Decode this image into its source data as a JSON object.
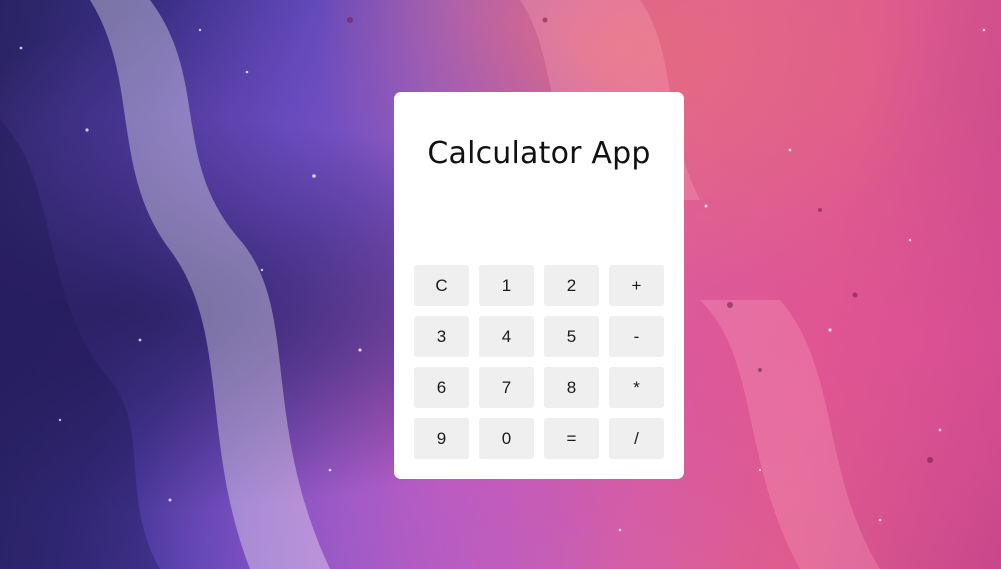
{
  "app": {
    "title": "Calculator App",
    "display_value": ""
  },
  "keys": [
    "C",
    "1",
    "2",
    "+",
    "3",
    "4",
    "5",
    "-",
    "6",
    "7",
    "8",
    "*",
    "9",
    "0",
    "=",
    "/"
  ],
  "colors": {
    "card": "#ffffff",
    "key_background": "#efefef",
    "text": "#111111"
  }
}
